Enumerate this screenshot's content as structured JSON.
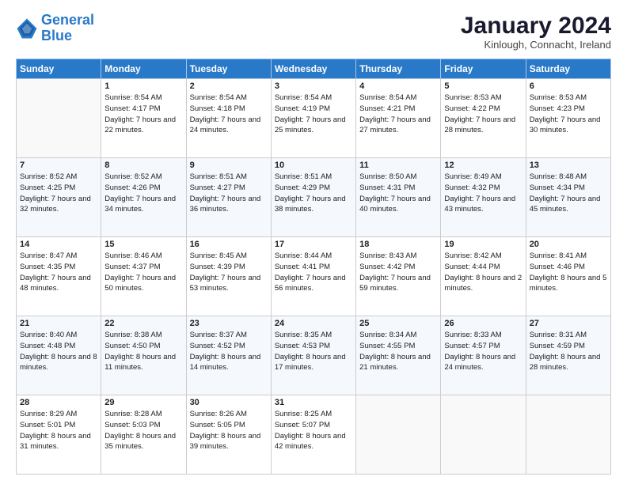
{
  "logo": {
    "line1": "General",
    "line2": "Blue"
  },
  "header": {
    "title": "January 2024",
    "subtitle": "Kinlough, Connacht, Ireland"
  },
  "weekdays": [
    "Sunday",
    "Monday",
    "Tuesday",
    "Wednesday",
    "Thursday",
    "Friday",
    "Saturday"
  ],
  "weeks": [
    [
      {
        "day": "",
        "sunrise": "",
        "sunset": "",
        "daylight": ""
      },
      {
        "day": "1",
        "sunrise": "Sunrise: 8:54 AM",
        "sunset": "Sunset: 4:17 PM",
        "daylight": "Daylight: 7 hours and 22 minutes."
      },
      {
        "day": "2",
        "sunrise": "Sunrise: 8:54 AM",
        "sunset": "Sunset: 4:18 PM",
        "daylight": "Daylight: 7 hours and 24 minutes."
      },
      {
        "day": "3",
        "sunrise": "Sunrise: 8:54 AM",
        "sunset": "Sunset: 4:19 PM",
        "daylight": "Daylight: 7 hours and 25 minutes."
      },
      {
        "day": "4",
        "sunrise": "Sunrise: 8:54 AM",
        "sunset": "Sunset: 4:21 PM",
        "daylight": "Daylight: 7 hours and 27 minutes."
      },
      {
        "day": "5",
        "sunrise": "Sunrise: 8:53 AM",
        "sunset": "Sunset: 4:22 PM",
        "daylight": "Daylight: 7 hours and 28 minutes."
      },
      {
        "day": "6",
        "sunrise": "Sunrise: 8:53 AM",
        "sunset": "Sunset: 4:23 PM",
        "daylight": "Daylight: 7 hours and 30 minutes."
      }
    ],
    [
      {
        "day": "7",
        "sunrise": "Sunrise: 8:52 AM",
        "sunset": "Sunset: 4:25 PM",
        "daylight": "Daylight: 7 hours and 32 minutes."
      },
      {
        "day": "8",
        "sunrise": "Sunrise: 8:52 AM",
        "sunset": "Sunset: 4:26 PM",
        "daylight": "Daylight: 7 hours and 34 minutes."
      },
      {
        "day": "9",
        "sunrise": "Sunrise: 8:51 AM",
        "sunset": "Sunset: 4:27 PM",
        "daylight": "Daylight: 7 hours and 36 minutes."
      },
      {
        "day": "10",
        "sunrise": "Sunrise: 8:51 AM",
        "sunset": "Sunset: 4:29 PM",
        "daylight": "Daylight: 7 hours and 38 minutes."
      },
      {
        "day": "11",
        "sunrise": "Sunrise: 8:50 AM",
        "sunset": "Sunset: 4:31 PM",
        "daylight": "Daylight: 7 hours and 40 minutes."
      },
      {
        "day": "12",
        "sunrise": "Sunrise: 8:49 AM",
        "sunset": "Sunset: 4:32 PM",
        "daylight": "Daylight: 7 hours and 43 minutes."
      },
      {
        "day": "13",
        "sunrise": "Sunrise: 8:48 AM",
        "sunset": "Sunset: 4:34 PM",
        "daylight": "Daylight: 7 hours and 45 minutes."
      }
    ],
    [
      {
        "day": "14",
        "sunrise": "Sunrise: 8:47 AM",
        "sunset": "Sunset: 4:35 PM",
        "daylight": "Daylight: 7 hours and 48 minutes."
      },
      {
        "day": "15",
        "sunrise": "Sunrise: 8:46 AM",
        "sunset": "Sunset: 4:37 PM",
        "daylight": "Daylight: 7 hours and 50 minutes."
      },
      {
        "day": "16",
        "sunrise": "Sunrise: 8:45 AM",
        "sunset": "Sunset: 4:39 PM",
        "daylight": "Daylight: 7 hours and 53 minutes."
      },
      {
        "day": "17",
        "sunrise": "Sunrise: 8:44 AM",
        "sunset": "Sunset: 4:41 PM",
        "daylight": "Daylight: 7 hours and 56 minutes."
      },
      {
        "day": "18",
        "sunrise": "Sunrise: 8:43 AM",
        "sunset": "Sunset: 4:42 PM",
        "daylight": "Daylight: 7 hours and 59 minutes."
      },
      {
        "day": "19",
        "sunrise": "Sunrise: 8:42 AM",
        "sunset": "Sunset: 4:44 PM",
        "daylight": "Daylight: 8 hours and 2 minutes."
      },
      {
        "day": "20",
        "sunrise": "Sunrise: 8:41 AM",
        "sunset": "Sunset: 4:46 PM",
        "daylight": "Daylight: 8 hours and 5 minutes."
      }
    ],
    [
      {
        "day": "21",
        "sunrise": "Sunrise: 8:40 AM",
        "sunset": "Sunset: 4:48 PM",
        "daylight": "Daylight: 8 hours and 8 minutes."
      },
      {
        "day": "22",
        "sunrise": "Sunrise: 8:38 AM",
        "sunset": "Sunset: 4:50 PM",
        "daylight": "Daylight: 8 hours and 11 minutes."
      },
      {
        "day": "23",
        "sunrise": "Sunrise: 8:37 AM",
        "sunset": "Sunset: 4:52 PM",
        "daylight": "Daylight: 8 hours and 14 minutes."
      },
      {
        "day": "24",
        "sunrise": "Sunrise: 8:35 AM",
        "sunset": "Sunset: 4:53 PM",
        "daylight": "Daylight: 8 hours and 17 minutes."
      },
      {
        "day": "25",
        "sunrise": "Sunrise: 8:34 AM",
        "sunset": "Sunset: 4:55 PM",
        "daylight": "Daylight: 8 hours and 21 minutes."
      },
      {
        "day": "26",
        "sunrise": "Sunrise: 8:33 AM",
        "sunset": "Sunset: 4:57 PM",
        "daylight": "Daylight: 8 hours and 24 minutes."
      },
      {
        "day": "27",
        "sunrise": "Sunrise: 8:31 AM",
        "sunset": "Sunset: 4:59 PM",
        "daylight": "Daylight: 8 hours and 28 minutes."
      }
    ],
    [
      {
        "day": "28",
        "sunrise": "Sunrise: 8:29 AM",
        "sunset": "Sunset: 5:01 PM",
        "daylight": "Daylight: 8 hours and 31 minutes."
      },
      {
        "day": "29",
        "sunrise": "Sunrise: 8:28 AM",
        "sunset": "Sunset: 5:03 PM",
        "daylight": "Daylight: 8 hours and 35 minutes."
      },
      {
        "day": "30",
        "sunrise": "Sunrise: 8:26 AM",
        "sunset": "Sunset: 5:05 PM",
        "daylight": "Daylight: 8 hours and 39 minutes."
      },
      {
        "day": "31",
        "sunrise": "Sunrise: 8:25 AM",
        "sunset": "Sunset: 5:07 PM",
        "daylight": "Daylight: 8 hours and 42 minutes."
      },
      {
        "day": "",
        "sunrise": "",
        "sunset": "",
        "daylight": ""
      },
      {
        "day": "",
        "sunrise": "",
        "sunset": "",
        "daylight": ""
      },
      {
        "day": "",
        "sunrise": "",
        "sunset": "",
        "daylight": ""
      }
    ]
  ]
}
